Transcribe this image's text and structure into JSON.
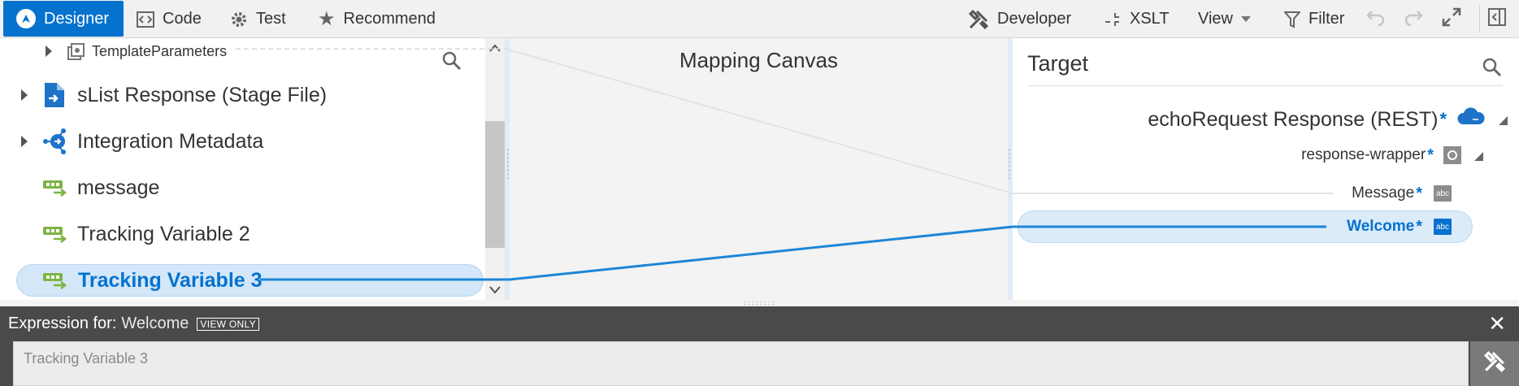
{
  "toolbar": {
    "designer": "Designer",
    "code": "Code",
    "test": "Test",
    "recommend": "Recommend",
    "developer": "Developer",
    "xslt": "XSLT",
    "view": "View",
    "filter": "Filter"
  },
  "source": {
    "items": [
      {
        "label": "TemplateParameters"
      },
      {
        "label": "sList Response (Stage File)"
      },
      {
        "label": "Integration Metadata"
      },
      {
        "label": "message"
      },
      {
        "label": "Tracking Variable 2"
      },
      {
        "label": "Tracking Variable 3"
      }
    ]
  },
  "canvas": {
    "title": "Mapping Canvas"
  },
  "target": {
    "title": "Target",
    "root": "echoRequest Response (REST)",
    "wrapper": "response-wrapper",
    "fields": [
      {
        "label": "Message",
        "type": "abc"
      },
      {
        "label": "Welcome",
        "type": "abc"
      }
    ],
    "required_mark": "*"
  },
  "expression": {
    "prefix": "Expression for:",
    "target": "Welcome",
    "badge": "VIEW ONLY",
    "value": "Tracking Variable 3"
  },
  "colors": {
    "accent": "#0572ce",
    "selected_bg": "#d3e7f8",
    "variable_icon": "#7cb342"
  }
}
